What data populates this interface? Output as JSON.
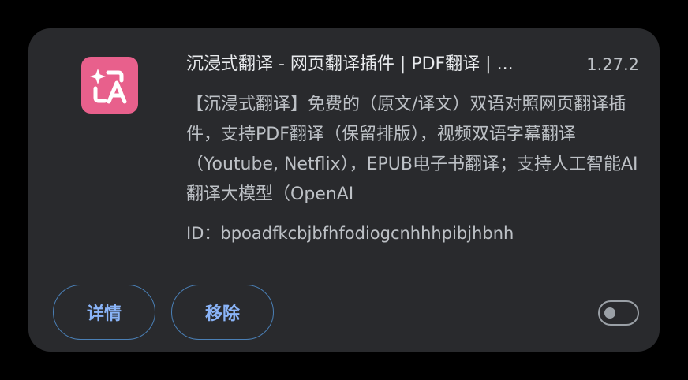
{
  "extension": {
    "name": "沉浸式翻译 - 网页翻译插件 | PDF翻译 | ...",
    "version": "1.27.2",
    "description": "【沉浸式翻译】免费的（原文/译文）双语对照网页翻译插件，支持PDF翻译（保留排版），视频双语字幕翻译（Youtube, Netflix），EPUB电子书翻译；支持人工智能AI翻译大模型（OpenAI",
    "id_text": "ID：bpoadfkcbjbfhfodiogcnhhhpibjhbnh",
    "icon": "sparkle-translate-icon",
    "icon_color": "#e8608c",
    "enabled": false
  },
  "actions": {
    "details_label": "详情",
    "remove_label": "移除"
  },
  "colors": {
    "card_background": "#292a2d",
    "button_text": "#8ab4f8",
    "primary_text": "#e8eaed",
    "secondary_text": "#bdc1c6"
  }
}
